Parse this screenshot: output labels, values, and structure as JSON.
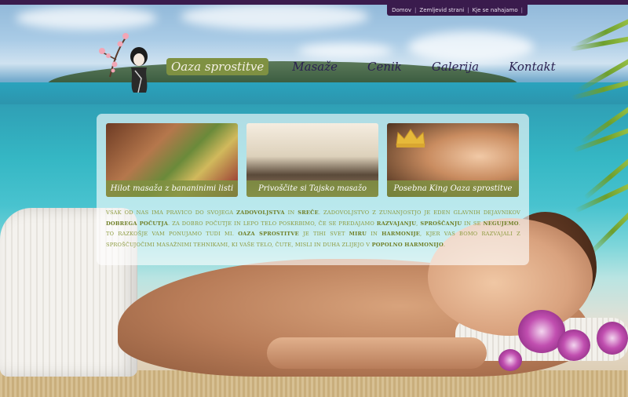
{
  "top_links": [
    "Domov",
    "Zemljevid strani",
    "Kje se nahajamo"
  ],
  "nav": {
    "items": [
      "Oaza sprostitve",
      "Masaže",
      "Cenik",
      "Galerija",
      "Kontakt"
    ],
    "active_index": 0
  },
  "cards": [
    {
      "caption": "Hilot masaža z bananinimi listi"
    },
    {
      "caption": "Privoščite si Tajsko masažo"
    },
    {
      "caption": "Posebna King Oaza sprostitve"
    }
  ],
  "intro": {
    "p1": "Vsak od nas ima pravico do svojega ",
    "b1": "zadovoljstva",
    "p2": " in ",
    "b2": "sreče",
    "p3": ". Zadovoljstvo z zunanjostjo je eden glavnih dejavnikov ",
    "b3": "dobrega počutja",
    "p4": ". Za dobro počutje in lepo telo poskrbimo, če se predajamo ",
    "b4": "razvajanju",
    "p5": ", ",
    "b5": "sproščanju",
    "p6": " in se ",
    "b6": "negujemo",
    "p7": ". To razkošje vam ponujamo tudi mi. ",
    "b7": "Oaza sprostitve",
    "p8": " je tihi svet ",
    "b8": "miru",
    "p9": " in ",
    "b9": "harmonije",
    "p10": ", kjer vas bomo razvajali z sproščujočimi masažnimi tehnikami, ki vaše telo, čute, misli in duha zlijejo v ",
    "b10": "popolno harmonijo",
    "p11": "."
  },
  "colors": {
    "accent_green": "#7f9142",
    "top_bar": "#3a1b4d",
    "nav_text": "#2b2050"
  },
  "icons": {
    "logo": "geisha-with-cherry-blossom-icon",
    "crown": "crown-icon"
  }
}
